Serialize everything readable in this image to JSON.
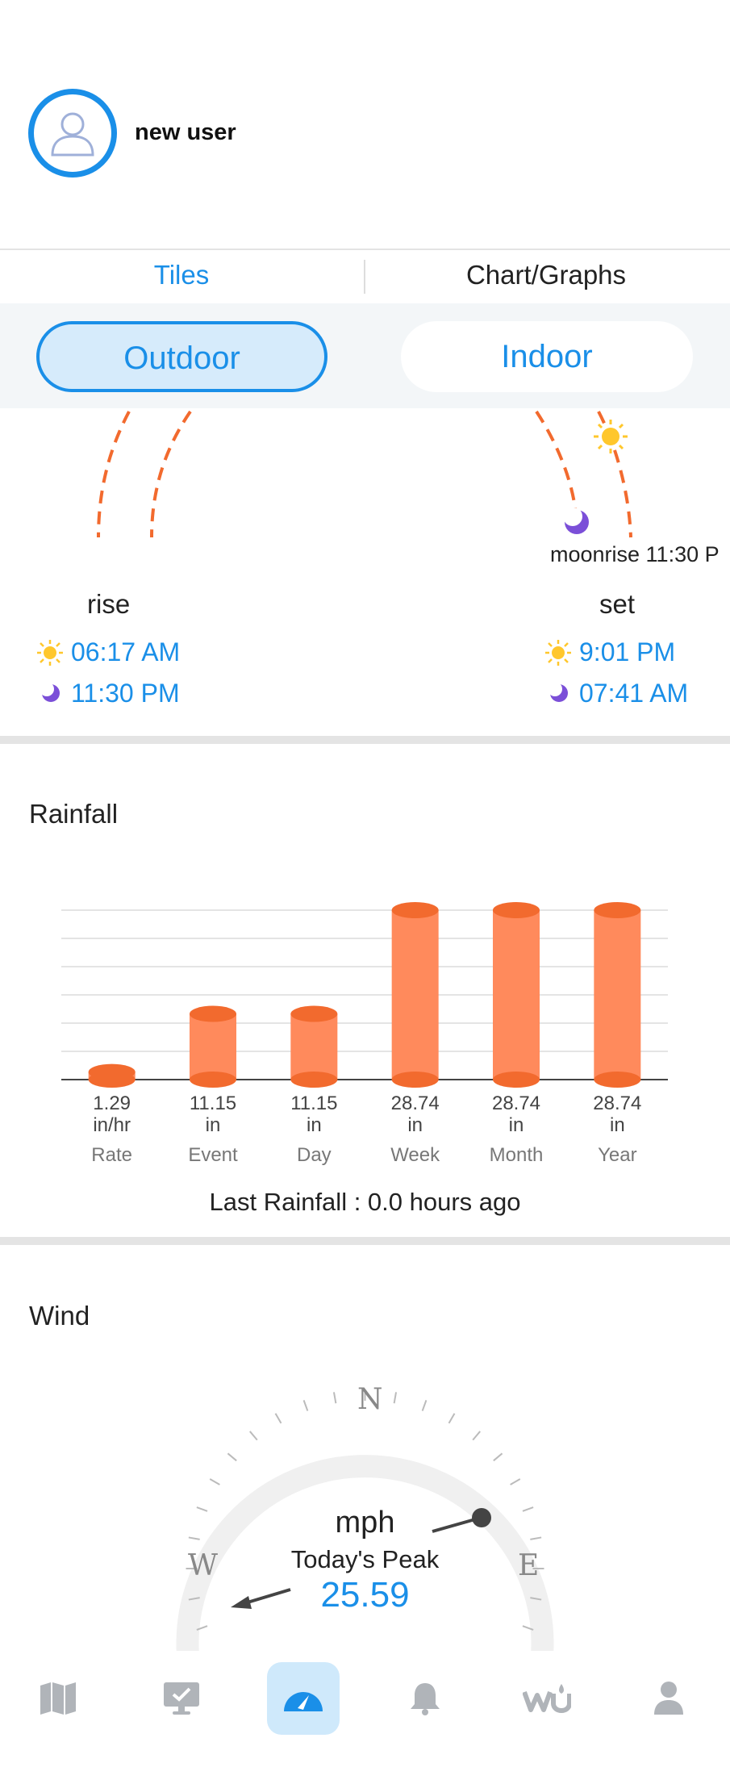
{
  "user": {
    "name": "new user"
  },
  "tabs": [
    {
      "label": "Tiles",
      "active": true
    },
    {
      "label": "Chart/Graphs",
      "active": false
    }
  ],
  "segments": [
    {
      "label": "Outdoor",
      "active": true
    },
    {
      "label": "Indoor",
      "active": false
    }
  ],
  "sun_moon": {
    "moon_label": "moonrise 11:30 P",
    "rise_label": "rise",
    "set_label": "set",
    "sunrise": "06:17 AM",
    "moonrise": "11:30 PM",
    "sunset": "9:01 PM",
    "moonset": "07:41 AM"
  },
  "rainfall": {
    "title": "Rainfall",
    "last_rainfall": "Last Rainfall : 0.0 hours ago"
  },
  "chart_data": {
    "type": "bar",
    "categories": [
      "Rate",
      "Event",
      "Day",
      "Week",
      "Month",
      "Year"
    ],
    "values": [
      1.29,
      11.15,
      11.15,
      28.74,
      28.74,
      28.74
    ],
    "value_labels": [
      "1.29",
      "11.15",
      "11.15",
      "28.74",
      "28.74",
      "28.74"
    ],
    "units": [
      "in/hr",
      "in",
      "in",
      "in",
      "in",
      "in"
    ],
    "ylim": [
      0,
      28.74
    ],
    "grid": true,
    "color": "#ff8a5c"
  },
  "wind": {
    "title": "Wind",
    "unit": "mph",
    "peak_label": "Today's Peak",
    "peak_value": "25.59",
    "compass": {
      "n": "N",
      "w": "W",
      "e": "E"
    }
  },
  "nav": [
    {
      "icon": "map-icon",
      "active": false
    },
    {
      "icon": "monitor-check-icon",
      "active": false
    },
    {
      "icon": "dashboard-gauge-icon",
      "active": true
    },
    {
      "icon": "bell-icon",
      "active": false
    },
    {
      "icon": "wunderground-logo-icon",
      "active": false
    },
    {
      "icon": "profile-icon",
      "active": false
    }
  ],
  "colors": {
    "accent": "#1a8fe8",
    "rain": "#ff8a5c",
    "moon": "#7b4fd8",
    "sun": "#ffc72c"
  }
}
